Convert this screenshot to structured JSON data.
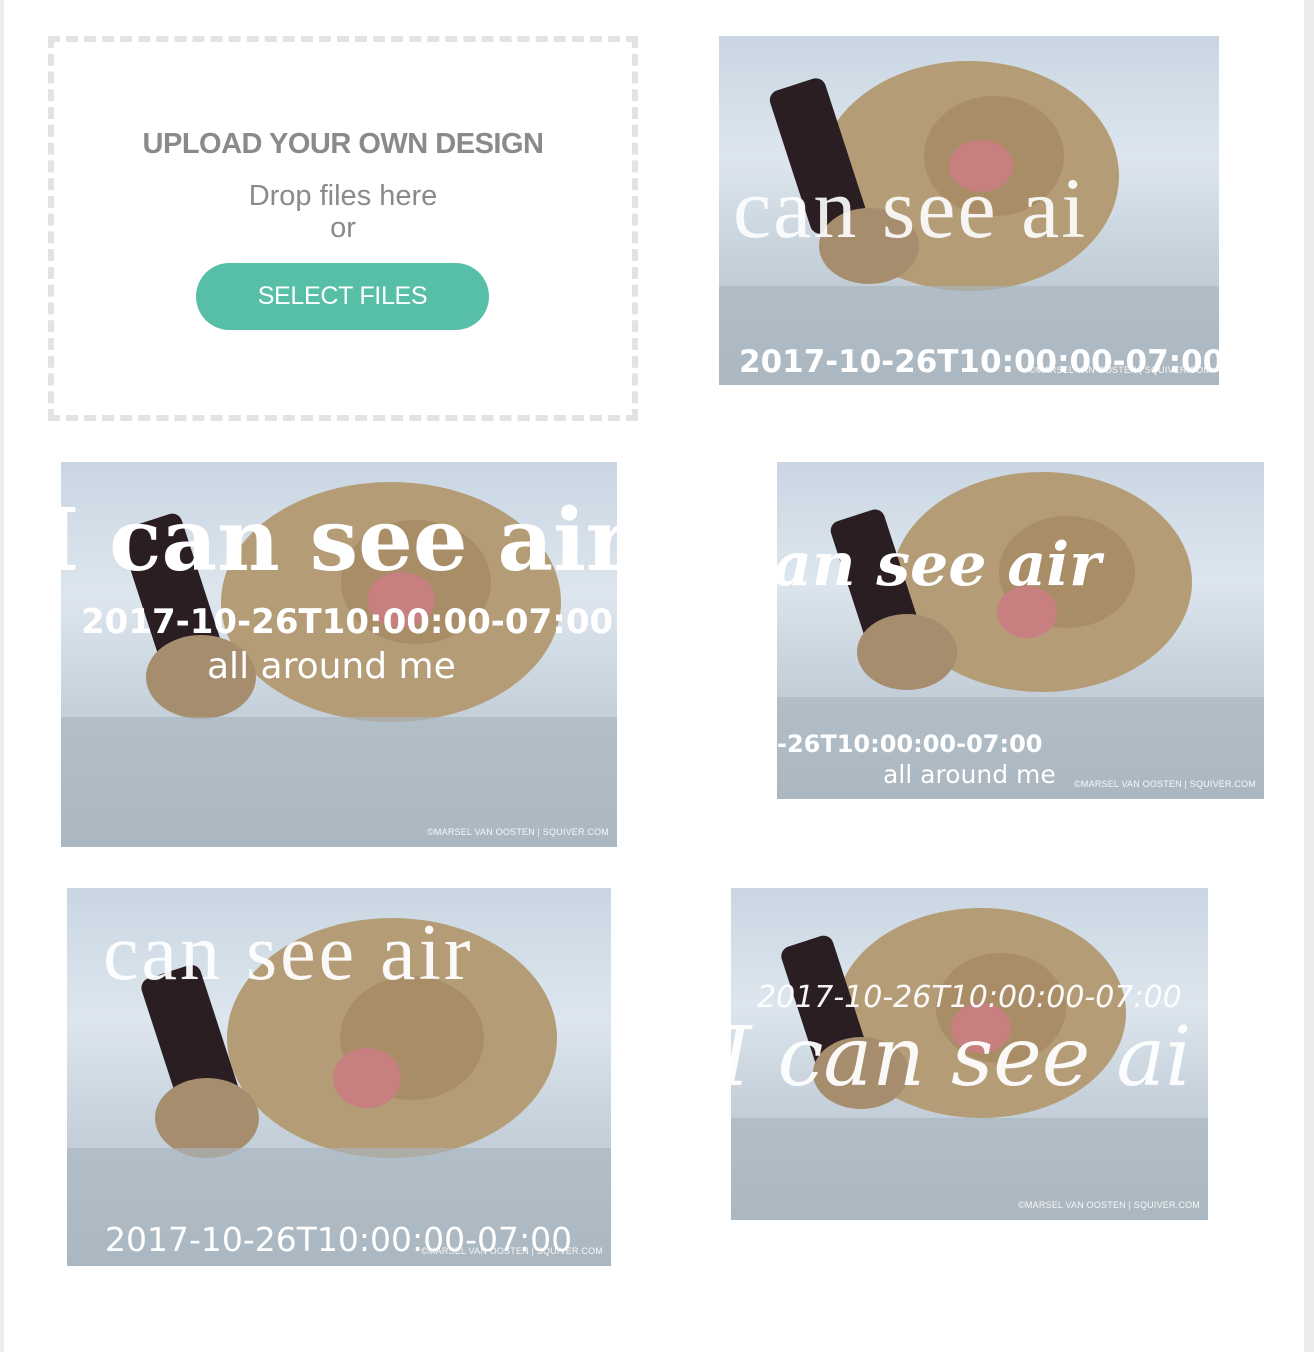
{
  "upload": {
    "title": "UPLOAD YOUR OWN DESIGN",
    "drop_text": "Drop files here",
    "or_text": "or",
    "button_label": "SELECT FILES"
  },
  "designs": [
    {
      "headline": "can see ai",
      "date": "2017-10-26T10:00:00-07:00",
      "credit": "©MARSEL VAN OOSTEN | SQUIVER.COM"
    },
    {
      "headline": "I can see air",
      "date": "2017-10-26T10:00:00-07:00",
      "subtext": "all around me",
      "credit": "©MARSEL VAN OOSTEN | SQUIVER.COM"
    },
    {
      "headline": "an see air",
      "date": "-26T10:00:00-07:00",
      "subtext": "all around me",
      "credit": "©MARSEL VAN OOSTEN | SQUIVER.COM"
    },
    {
      "headline": "can see air",
      "date": "2017-10-26T10:00:00-07:00",
      "credit": "©MARSEL VAN OOSTEN | SQUIVER.COM"
    },
    {
      "headline": "I can see ai",
      "date": "2017-10-26T10:00:00-07:00",
      "credit": "©MARSEL VAN OOSTEN | SQUIVER.COM"
    }
  ],
  "colors": {
    "accent": "#57bfa8",
    "dashed_border": "#e3e3e3",
    "upload_text": "#8a8a8a"
  },
  "icons": {
    "photo": "snow-monkey-with-phone-photo"
  }
}
